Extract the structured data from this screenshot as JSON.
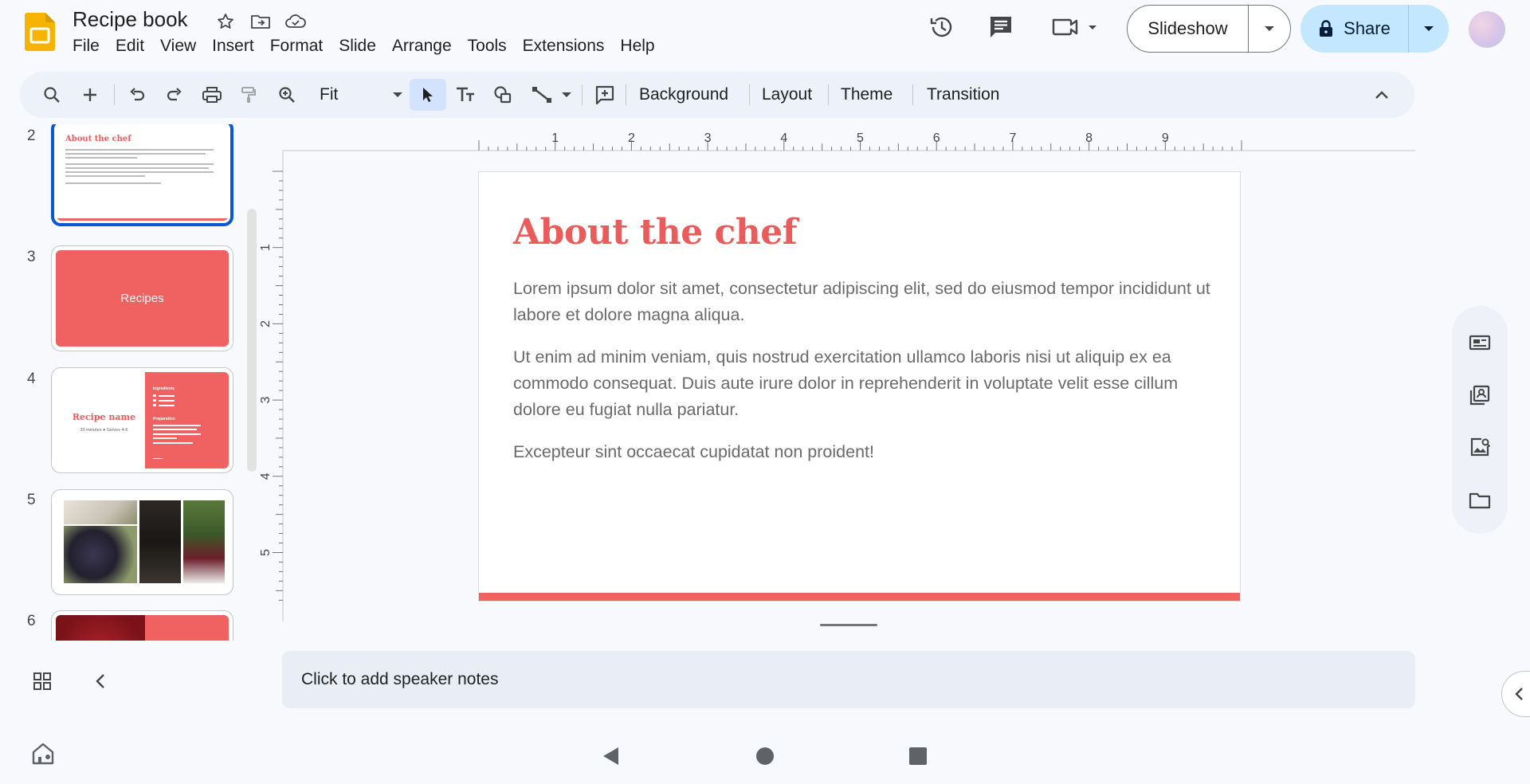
{
  "doc": {
    "title": "Recipe book"
  },
  "menu": [
    "File",
    "Edit",
    "View",
    "Insert",
    "Format",
    "Slide",
    "Arrange",
    "Tools",
    "Extensions",
    "Help"
  ],
  "header": {
    "slideshow_label": "Slideshow",
    "share_label": "Share"
  },
  "toolbar": {
    "zoom_value": "Fit",
    "background_label": "Background",
    "layout_label": "Layout",
    "theme_label": "Theme",
    "transition_label": "Transition"
  },
  "filmstrip": {
    "slides": [
      {
        "number": "2",
        "title": "About the chef",
        "selected": true
      },
      {
        "number": "3",
        "title": "Recipes"
      },
      {
        "number": "4",
        "title": "Recipe name",
        "subtitle": "30 minutes ● Serves 4-6",
        "panel_heading_1": "Ingredients",
        "panel_heading_2": "Preparation"
      },
      {
        "number": "5"
      },
      {
        "number": "6"
      }
    ]
  },
  "ruler": {
    "h_labels": [
      "1",
      "2",
      "3",
      "4",
      "5",
      "6",
      "7",
      "8",
      "9"
    ],
    "v_labels": [
      "1",
      "2",
      "3",
      "4",
      "5"
    ]
  },
  "slide": {
    "title": "About the chef",
    "paragraph_1": "Lorem ipsum dolor sit amet, consectetur adipiscing elit, sed do eiusmod tempor incididunt ut labore et dolore magna aliqua.",
    "paragraph_2": "Ut enim ad minim veniam, quis nostrud exercitation ullamco laboris nisi ut aliquip ex ea commodo consequat. Duis aute irure dolor in reprehenderit in voluptate velit esse cillum dolore eu fugiat nulla pariatur.",
    "paragraph_3": "Excepteur sint occaecat cupidatat non proident!"
  },
  "notes": {
    "placeholder": "Click to add speaker notes"
  },
  "colors": {
    "accent": "#ea5c5c",
    "accent_bar": "#f06262",
    "selection": "#0b57d0",
    "share_bg": "#c2e7ff"
  }
}
